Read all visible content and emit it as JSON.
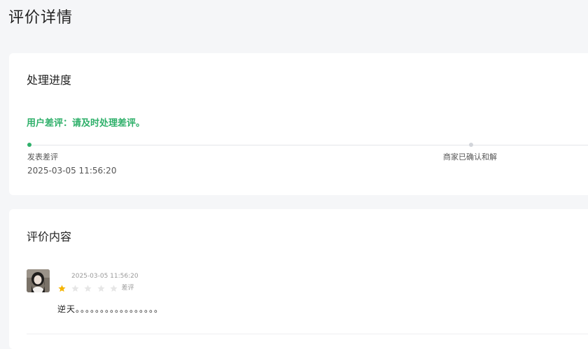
{
  "page": {
    "title": "评价详情"
  },
  "progress": {
    "section_title": "处理进度",
    "status_text": "用户差评：请及时处理差评。",
    "status_color": "#2fb06a",
    "steps": [
      {
        "label": "发表差评",
        "time": "2025-03-05 11:56:20",
        "state": "done"
      },
      {
        "label": "商家已确认和解",
        "state": "pending"
      }
    ]
  },
  "review": {
    "section_title": "评价内容",
    "time": "2025-03-05 11:56:20",
    "rating": 1,
    "rating_max": 5,
    "rating_label": "差评",
    "star_color_filled": "#f5b400",
    "star_color_empty": "#e6e6e6",
    "content": "逆天。。。。。。。。。。。。。。。。。"
  }
}
